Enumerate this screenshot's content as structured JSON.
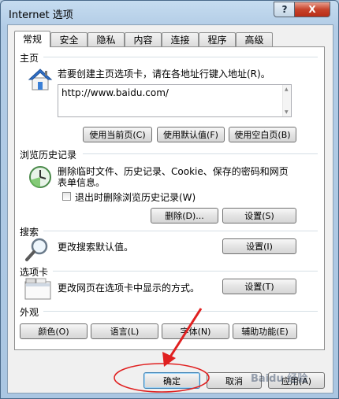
{
  "window": {
    "title": "Internet 选项",
    "help_label": "?",
    "close_label": "X"
  },
  "tabs": [
    "常规",
    "安全",
    "隐私",
    "内容",
    "连接",
    "程序",
    "高级"
  ],
  "home": {
    "label": "主页",
    "description": "若要创建主页选项卡，请在各地址行键入地址(R)。",
    "url_value": "http://www.baidu.com/",
    "buttons": {
      "use_current": "使用当前页(C)",
      "use_default": "使用默认值(F)",
      "use_blank": "使用空白页(B)"
    }
  },
  "history": {
    "label": "浏览历史记录",
    "description_line1": "删除临时文件、历史记录、Cookie、保存的密码和网页",
    "description_line2": "表单信息。",
    "checkbox_label": "退出时删除浏览历史记录(W)",
    "checkbox_checked": false,
    "buttons": {
      "delete": "删除(D)...",
      "settings": "设置(S)"
    }
  },
  "search": {
    "label": "搜索",
    "description": "更改搜索默认值。",
    "settings": "设置(I)"
  },
  "tabs_section": {
    "label": "选项卡",
    "description": "更改网页在选项卡中显示的方式。",
    "settings": "设置(T)"
  },
  "appearance": {
    "label": "外观",
    "buttons": {
      "colors": "颜色(O)",
      "languages": "语言(L)",
      "fonts": "字体(N)",
      "accessibility": "辅助功能(E)"
    }
  },
  "footer": {
    "ok": "确定",
    "cancel": "取消",
    "apply": "应用(A)"
  },
  "watermark": "Baidu 经验",
  "colors": {
    "annotation_red": "#e02020"
  }
}
